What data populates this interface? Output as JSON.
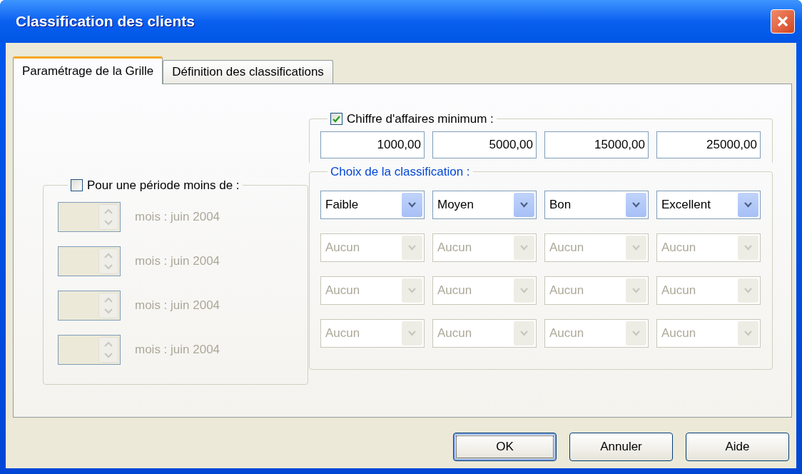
{
  "window": {
    "title": "Classification des clients"
  },
  "tabs": [
    {
      "label": "Paramétrage de la Grille",
      "selected": true
    },
    {
      "label": "Définition des classifications",
      "selected": false
    }
  ],
  "period_group": {
    "label": "Pour une période moins de :",
    "checked": false,
    "rows": [
      {
        "label": "mois : juin 2004",
        "disabled": true
      },
      {
        "label": "mois : juin 2004",
        "disabled": true
      },
      {
        "label": "mois : juin 2004",
        "disabled": true
      },
      {
        "label": "mois : juin 2004",
        "disabled": true
      }
    ]
  },
  "turnover_group": {
    "label": "Chiffre d'affaires minimum :",
    "checked": true,
    "fields": [
      "1000,00",
      "5000,00",
      "15000,00",
      "25000,00"
    ]
  },
  "classification_group": {
    "label": "Choix de la classification :",
    "rows": [
      [
        {
          "value": "Faible",
          "disabled": false
        },
        {
          "value": "Moyen",
          "disabled": false
        },
        {
          "value": "Bon",
          "disabled": false
        },
        {
          "value": "Excellent",
          "disabled": false
        }
      ],
      [
        {
          "value": "Aucun",
          "disabled": true
        },
        {
          "value": "Aucun",
          "disabled": true
        },
        {
          "value": "Aucun",
          "disabled": true
        },
        {
          "value": "Aucun",
          "disabled": true
        }
      ],
      [
        {
          "value": "Aucun",
          "disabled": true
        },
        {
          "value": "Aucun",
          "disabled": true
        },
        {
          "value": "Aucun",
          "disabled": true
        },
        {
          "value": "Aucun",
          "disabled": true
        }
      ],
      [
        {
          "value": "Aucun",
          "disabled": true
        },
        {
          "value": "Aucun",
          "disabled": true
        },
        {
          "value": "Aucun",
          "disabled": true
        },
        {
          "value": "Aucun",
          "disabled": true
        }
      ]
    ]
  },
  "buttons": [
    {
      "label": "OK",
      "focused": true
    },
    {
      "label": "Annuler",
      "focused": false
    },
    {
      "label": "Aide",
      "focused": false
    }
  ]
}
